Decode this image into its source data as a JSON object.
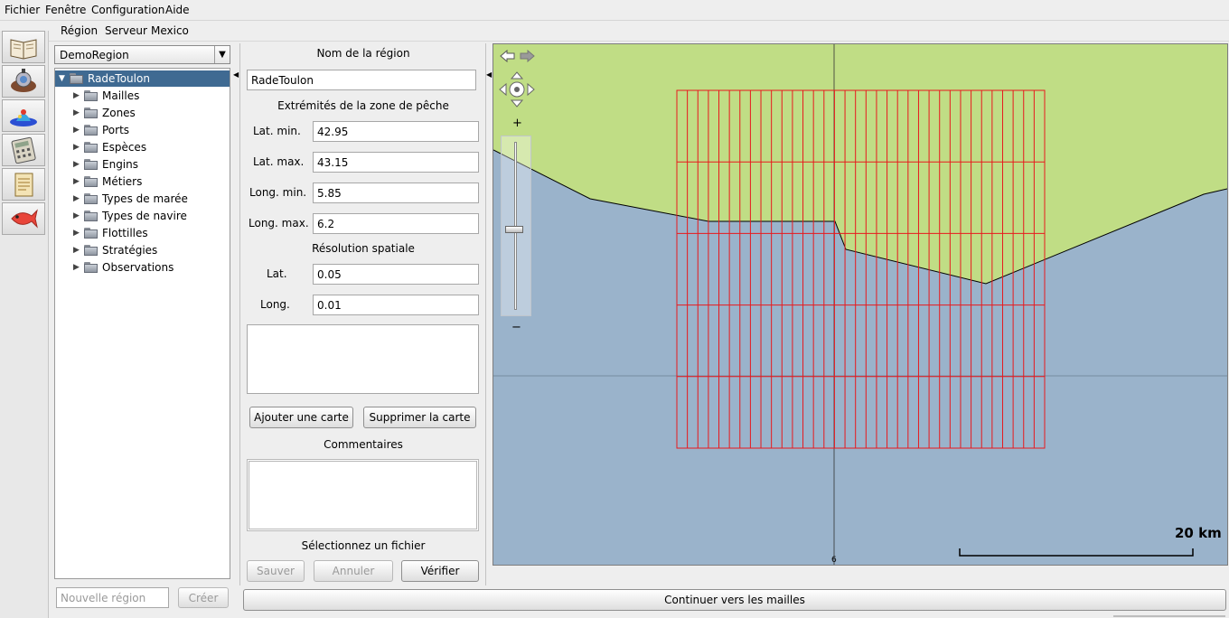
{
  "menubar": {
    "items": [
      "Fichier",
      "Fenêtre",
      "Configuration",
      "Aide"
    ]
  },
  "submenu": {
    "items": [
      "Région",
      "Serveur",
      "Mexico"
    ]
  },
  "toolbar": {
    "icons": [
      "book-icon",
      "diver-icon",
      "fish-stock-icon",
      "calculator-icon",
      "document-icon",
      "red-fish-icon"
    ]
  },
  "region_selector": {
    "value": "DemoRegion"
  },
  "tree": {
    "root": "RadeToulon",
    "children": [
      "Mailles",
      "Zones",
      "Ports",
      "Espèces",
      "Engins",
      "Métiers",
      "Types de marée",
      "Types de navire",
      "Flottilles",
      "Stratégies",
      "Observations"
    ]
  },
  "new_region": {
    "placeholder": "Nouvelle région",
    "create_label": "Créer"
  },
  "form": {
    "name_title": "Nom de la région",
    "name_value": "RadeToulon",
    "extent_title": "Extrémités de la zone de pêche",
    "lat_min_label": "Lat. min.",
    "lat_min_value": "42.95",
    "lat_max_label": "Lat. max.",
    "lat_max_value": "43.15",
    "long_min_label": "Long. min.",
    "long_min_value": "5.85",
    "long_max_label": "Long. max.",
    "long_max_value": "6.2",
    "resolution_title": "Résolution spatiale",
    "lat_label": "Lat.",
    "lat_value": "0.05",
    "long_label": "Long.",
    "long_value": "0.01",
    "add_map_label": "Ajouter une carte",
    "remove_map_label": "Supprimer la carte",
    "comments_title": "Commentaires",
    "select_file_title": "Sélectionnez un fichier",
    "save_label": "Sauver",
    "cancel_label": "Annuler",
    "verify_label": "Vérifier"
  },
  "map": {
    "land_color": "#c0dd85",
    "sea_color": "#9ab3cb",
    "grid_color": "#e8191d",
    "axis_label": "6",
    "scale_label": "20 km",
    "zoom_in": "+",
    "zoom_out": "−",
    "zoom_level": 0.52,
    "grid_rows": 5,
    "grid_cols": 35
  },
  "continue_label": "Continuer vers les mailles"
}
